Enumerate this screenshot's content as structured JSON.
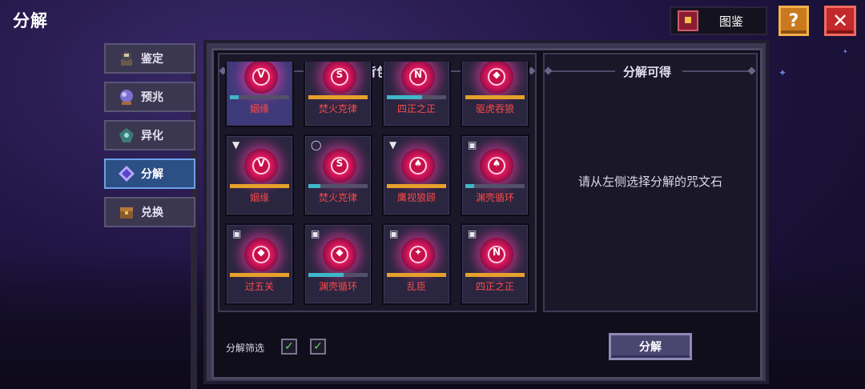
{
  "header": {
    "title": "分解"
  },
  "top_right": {
    "codex_label": "图鉴",
    "help_label": "?",
    "close_label": "✕"
  },
  "tabs": [
    {
      "label": "鉴定",
      "icon": "identify-icon",
      "active": false
    },
    {
      "label": "预兆",
      "icon": "omen-icon",
      "active": false
    },
    {
      "label": "异化",
      "icon": "mutate-icon",
      "active": false
    },
    {
      "label": "分解",
      "icon": "decompose-icon",
      "active": true
    },
    {
      "label": "兑换",
      "icon": "exchange-icon",
      "active": false
    }
  ],
  "bag": {
    "title": "背包",
    "items": [
      {
        "name": "姻缘",
        "symbol": "V",
        "badge": "",
        "progress": 0.15,
        "bar": "teal",
        "highlight": true
      },
      {
        "name": "焚火克律",
        "symbol": "S",
        "badge": "",
        "progress": 1.0,
        "bar": "orange",
        "highlight": false
      },
      {
        "name": "四正之正",
        "symbol": "N",
        "badge": "",
        "progress": 0.6,
        "bar": "teal",
        "highlight": false
      },
      {
        "name": "驱虎吞狼",
        "symbol": "◆",
        "badge": "",
        "progress": 1.0,
        "bar": "orange",
        "highlight": false
      },
      {
        "name": "姻缘",
        "symbol": "V",
        "badge": "sword",
        "progress": 1.0,
        "bar": "orange",
        "highlight": false
      },
      {
        "name": "焚火克律",
        "symbol": "S",
        "badge": "ring",
        "progress": 0.2,
        "bar": "teal",
        "highlight": false
      },
      {
        "name": "鹰视狼顾",
        "symbol": "♠",
        "badge": "sword",
        "progress": 1.0,
        "bar": "orange",
        "highlight": false
      },
      {
        "name": "渊壳循环",
        "symbol": "♠",
        "badge": "helmet",
        "progress": 0.15,
        "bar": "teal",
        "highlight": false
      },
      {
        "name": "过五关",
        "symbol": "◆",
        "badge": "helmet",
        "progress": 1.0,
        "bar": "orange",
        "highlight": false
      },
      {
        "name": "渊壳循环",
        "symbol": "◆",
        "badge": "helmet",
        "progress": 0.6,
        "bar": "teal",
        "highlight": false
      },
      {
        "name": "乱臣",
        "symbol": "✦",
        "badge": "helmet",
        "progress": 1.0,
        "bar": "orange",
        "highlight": false
      },
      {
        "name": "四正之正",
        "symbol": "N",
        "badge": "helmet",
        "progress": 1.0,
        "bar": "orange",
        "highlight": false
      }
    ]
  },
  "result": {
    "title": "分解可得",
    "empty_hint": "请从左侧选择分解的咒文石"
  },
  "footer": {
    "filter_label": "分解筛选",
    "checkbox_1": true,
    "checkbox_2": true,
    "decompose_button": "分解"
  },
  "colors": {
    "accent_tab": "#2c4f86",
    "rune_name": "#ff4a4a",
    "bar_orange": "#e6a12c",
    "bar_teal": "#3fb7c8"
  }
}
